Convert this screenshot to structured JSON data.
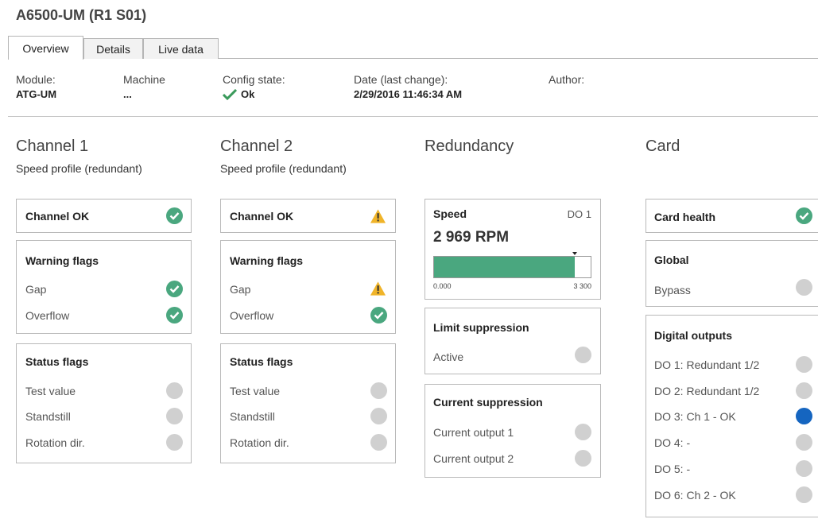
{
  "title": "A6500-UM (R1 S01)",
  "tabs": [
    "Overview",
    "Details",
    "Live data"
  ],
  "header": {
    "module_label": "Module:",
    "module_value": "ATG-UM",
    "machine_label": "Machine",
    "machine_value": "...",
    "config_label": "Config state:",
    "config_value": "Ok",
    "date_label": "Date (last change):",
    "date_value": "2/29/2016 11:46:34 AM",
    "author_label": "Author:"
  },
  "channel1": {
    "title": "Channel 1",
    "subtitle": "Speed profile (redundant)",
    "status_label": "Channel OK",
    "warning_title": "Warning flags",
    "warning_rows": [
      "Gap",
      "Overflow"
    ],
    "status_title": "Status flags",
    "status_rows": [
      "Test value",
      "Standstill",
      "Rotation dir."
    ]
  },
  "channel2": {
    "title": "Channel 2",
    "subtitle": "Speed profile (redundant)",
    "status_label": "Channel OK",
    "warning_title": "Warning flags",
    "warning_rows": [
      "Gap",
      "Overflow"
    ],
    "status_title": "Status flags",
    "status_rows": [
      "Test value",
      "Standstill",
      "Rotation dir."
    ]
  },
  "redundancy": {
    "title": "Redundancy",
    "speed_label": "Speed",
    "speed_do": "DO 1",
    "speed_value": "2 969 RPM",
    "speed_fraction": 0.9,
    "scale_min": "0.000",
    "scale_max": "3 300",
    "limit_title": "Limit suppression",
    "limit_row": "Active",
    "current_title": "Current suppression",
    "current_rows": [
      "Current output 1",
      "Current output 2"
    ]
  },
  "card": {
    "title": "Card",
    "health_label": "Card health",
    "global_title": "Global",
    "global_row": "Bypass",
    "do_title": "Digital outputs",
    "do_rows": [
      "DO 1: Redundant 1/2",
      "DO 2: Redundant 1/2",
      "DO 3: Ch 1 - OK",
      "DO 4: -",
      "DO 5: -",
      "DO 6: Ch 2 - OK"
    ]
  },
  "colors": {
    "ok": "#4aa77f",
    "warn": "#f0b429",
    "active": "#1565c0",
    "inactive": "#d0d0d0"
  },
  "icons": {
    "ok": "check-circle-icon",
    "warn": "warning-triangle-icon",
    "config_ok": "checkmark-icon"
  }
}
